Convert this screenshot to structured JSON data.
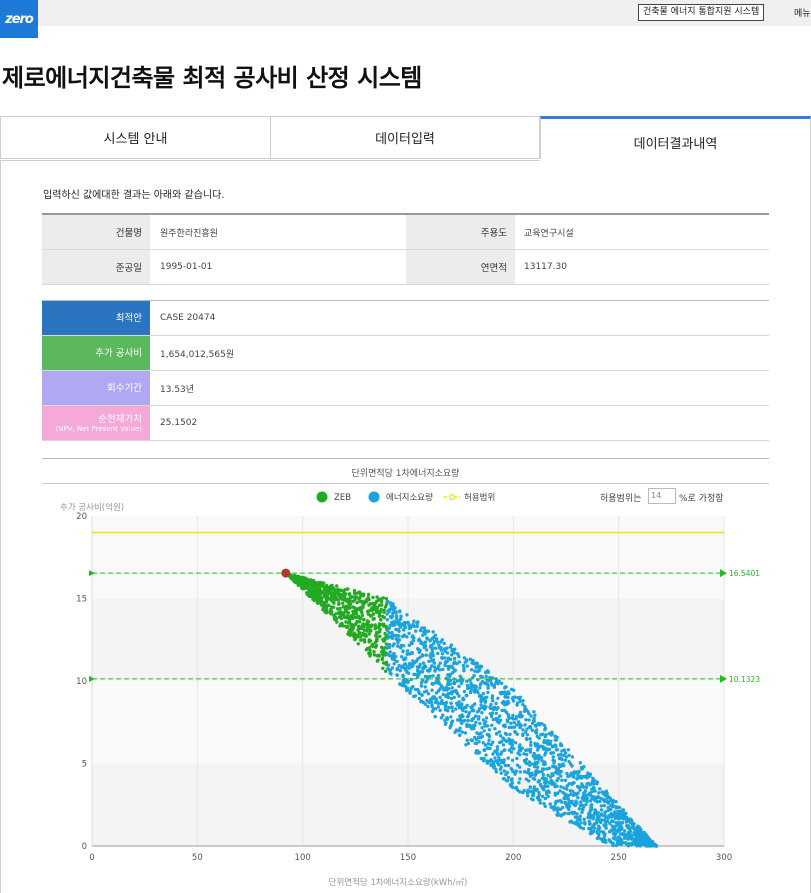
{
  "header": {
    "logo": "zero",
    "sys_link": "건축물 에너지 통합지원 시스템",
    "menu": "메뉴"
  },
  "page_title": "제로에너지건축물 최적 공사비 산정 시스템",
  "tabs": [
    "시스템 안내",
    "데이터입력",
    "데이터결과내역"
  ],
  "intro": "입력하신 값에대한 결과는 아래와 같습니다.",
  "building": {
    "name_label": "건물명",
    "name": "원주한라진흥원",
    "use_label": "주용도",
    "use": "교육연구시설",
    "completion_label": "준공일",
    "completion": "1995-01-01",
    "area_label": "연면적",
    "area": "13117.30"
  },
  "results": [
    {
      "label": "최적안",
      "value": "CASE 20474",
      "color": "#2a74c0"
    },
    {
      "label": "추가 공사비",
      "value": "1,654,012,565원",
      "color": "#5cb85c"
    },
    {
      "label": "회수기간",
      "value": "13.53년",
      "color": "#b0a8f3"
    },
    {
      "label": "순현재가치",
      "sub": "(NPV, Net Present Value)",
      "value": "25.1502",
      "color": "#f4a9d9"
    }
  ],
  "tolerance": {
    "label": "허용범위는",
    "value": "14",
    "unit": "%로 가정함"
  },
  "chart_data": {
    "type": "scatter",
    "title": "단위면적당 1차에너지소요량",
    "xlabel": "단위면적당 1차에너지소요량(kWh/㎡)",
    "ylabel": "추가 공사비(억원)",
    "xlim": [
      0,
      300
    ],
    "ylim": [
      0,
      20
    ],
    "xticks": [
      0,
      50,
      100,
      150,
      200,
      250,
      300
    ],
    "yticks": [
      0,
      5,
      10,
      15,
      20
    ],
    "legend": [
      {
        "name": "ZEB",
        "color": "#22aa22"
      },
      {
        "name": "에너지소요량",
        "color": "#1aa3dd"
      },
      {
        "name": "허용범위",
        "color": "#e8e800"
      }
    ],
    "legend_position": "top-center",
    "tolerance_line": 19,
    "ref_lines": [
      {
        "y": 16.5401,
        "label": "16.5401",
        "color": "#22bb22"
      },
      {
        "y": 10.1323,
        "label": "10.1323",
        "color": "#22bb22"
      }
    ],
    "optimal_point": {
      "x": 92,
      "y": 16.54,
      "color": "#b03a2e"
    },
    "zeb_region": {
      "x_min": 92,
      "x_max": 140,
      "color": "#22aa22"
    },
    "cloud_band": {
      "upper": [
        [
          92,
          16.54
        ],
        [
          140,
          15.0
        ],
        [
          200,
          9.5
        ],
        [
          268,
          0.0
        ]
      ],
      "lower": [
        [
          92,
          16.54
        ],
        [
          140,
          10.5
        ],
        [
          200,
          3.5
        ],
        [
          245,
          0.0
        ]
      ],
      "color": "#1aa3dd"
    }
  }
}
